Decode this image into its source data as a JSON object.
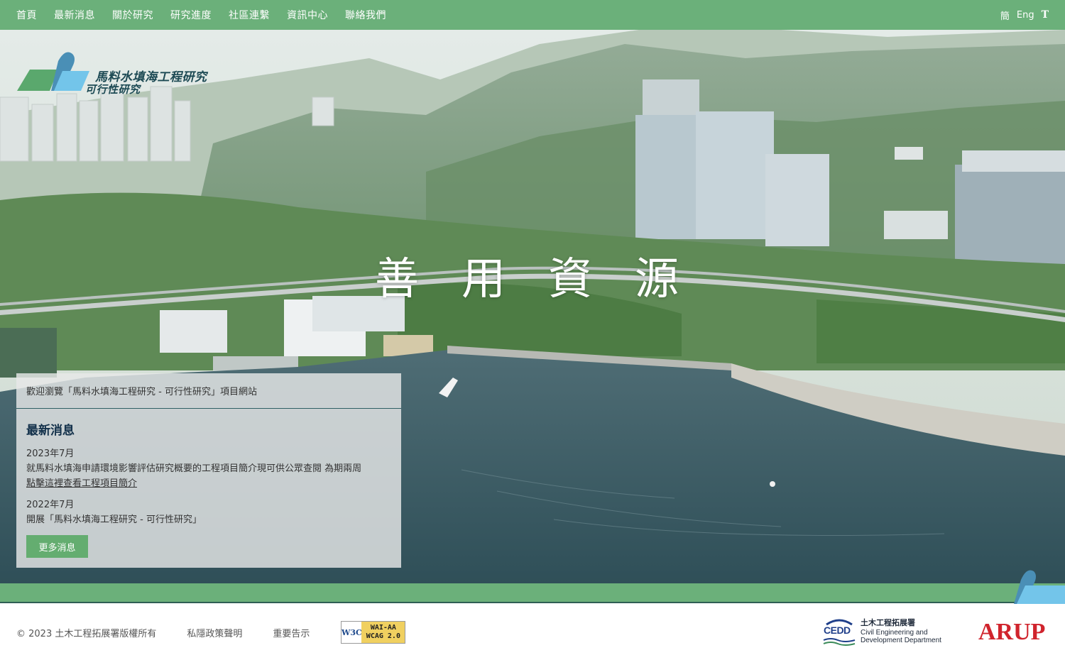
{
  "nav": {
    "items": [
      "首頁",
      "最新消息",
      "關於研究",
      "研究進度",
      "社區連繫",
      "資訊中心",
      "聯絡我們"
    ],
    "lang": {
      "simplified": "簡",
      "english": "Eng",
      "text_size": "T"
    }
  },
  "logo": {
    "line1": "馬料水填海工程研究",
    "line2": "可行性研究"
  },
  "hero": {
    "slogan": "善用資源"
  },
  "panel": {
    "welcome": "歡迎瀏覽「馬料水填海工程研究 - 可行性研究」項目網站",
    "heading": "最新消息",
    "news": [
      {
        "date": "2023年7月",
        "text": "就馬料水填海申請環境影響評估研究概要的工程項目簡介現可供公眾查閱 為期兩周",
        "link": "點擊這裡查看工程項目簡介"
      },
      {
        "date": "2022年7月",
        "text": "開展「馬料水填海工程研究 - 可行性研究」",
        "link": ""
      }
    ],
    "more_button": "更多消息"
  },
  "footer": {
    "copyright": "© 2023 土木工程拓展署版權所有",
    "privacy": "私隱政策聲明",
    "notice": "重要告示",
    "w3c": {
      "left": "W3C",
      "line1": "WAI-AA",
      "line2": "WCAG 2.0"
    },
    "cedd": {
      "abbr": "CEDD",
      "zh": "土木工程拓展署",
      "en1": "Civil Engineering and",
      "en2": "Development Department"
    },
    "arup": "ARUP"
  },
  "colors": {
    "brand_green": "#6bb07a",
    "button_green": "#64ad70",
    "arup_red": "#d0242d",
    "cedd_blue": "#1f3f8a"
  }
}
